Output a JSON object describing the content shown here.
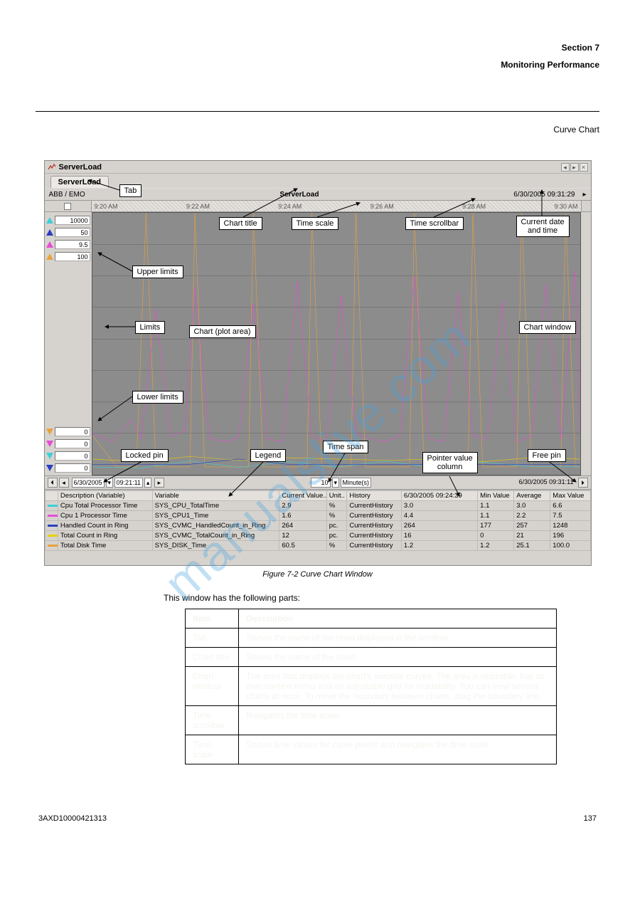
{
  "header": {
    "section_num": "Section 7",
    "section_title": "Monitoring Performance",
    "subtitle": "Curve Chart"
  },
  "watermark": "manualslive.com",
  "window": {
    "title": "ServerLoad",
    "tab_label": "ServerLoad",
    "path_left": "ABB / EMO",
    "path_center": "ServerLoad",
    "datetime_topright": "6/30/2005 09:31:29",
    "time_ticks": [
      "9:20 AM",
      "9:22 AM",
      "9:24 AM",
      "9:26 AM",
      "9:28 AM",
      "9:30 AM"
    ],
    "upper_limits": [
      {
        "color": "#3dd0d6",
        "value": "10000"
      },
      {
        "color": "#2a3ec0",
        "value": "50"
      },
      {
        "color": "#e84bd6",
        "value": "9.5"
      },
      {
        "color": "#e8a23c",
        "value": "100"
      }
    ],
    "lower_limits": [
      {
        "color": "#e8a23c",
        "value": "0"
      },
      {
        "color": "#e84bd6",
        "value": "0"
      },
      {
        "color": "#3dd0d6",
        "value": "0"
      },
      {
        "color": "#2a3ec0",
        "value": "0"
      }
    ],
    "bottombar": {
      "date": "6/30/2005",
      "time": "09:21:11",
      "span_value": "10",
      "span_unit": "Minute(s)",
      "right_datetime": "6/30/2005 09:31:11"
    },
    "legend_headers": [
      "",
      "Description (Variable)",
      "Variable",
      "Current Value..",
      "Unit..",
      "History",
      "6/30/2005 09:24:39",
      "Min Value",
      "Average",
      "Max Value"
    ],
    "legend_rows": [
      {
        "color": "#3dd0d6",
        "desc": "Cpu Total Processor Time",
        "var": "SYS_CPU_TotalTime",
        "cv": "2.9",
        "unit": "%",
        "hist": "CurrentHistory",
        "pv": "3.0",
        "min": "1.1",
        "avg": "3.0",
        "max": "6.6"
      },
      {
        "color": "#e84bd6",
        "desc": "Cpu 1 Processor Time",
        "var": "SYS_CPU1_Time",
        "cv": "1.6",
        "unit": "%",
        "hist": "CurrentHistory",
        "pv": "4.4",
        "min": "1.1",
        "avg": "2.2",
        "max": "7.5"
      },
      {
        "color": "#2a3ec0",
        "desc": "Handled Count in Ring",
        "var": "SYS_CVMC_HandledCount_in_Ring",
        "cv": "264",
        "unit": "pc.",
        "hist": "CurrentHistory",
        "pv": "264",
        "min": "177",
        "avg": "257",
        "max": "1248"
      },
      {
        "color": "#e8d000",
        "desc": "Total Count in Ring",
        "var": "SYS_CVMC_TotalCount_in_Ring",
        "cv": "12",
        "unit": "pc.",
        "hist": "CurrentHistory",
        "pv": "16",
        "min": "0",
        "avg": "21",
        "max": "196"
      },
      {
        "color": "#e8a23c",
        "desc": "Total Disk Time",
        "var": "SYS_DISK_Time",
        "cv": "60.5",
        "unit": "%",
        "hist": "CurrentHistory",
        "pv": "1.2",
        "min": "1.2",
        "avg": "25.1",
        "max": "100.0"
      }
    ]
  },
  "callouts": {
    "tab": "Tab",
    "chart_title": "Chart title",
    "time_scale": "Time scale",
    "time_scrollbar": "Time scrollbar",
    "current_dt": "Current date\nand time",
    "upper_limits": "Upper limits",
    "limits": "Limits",
    "chart_plot": "Chart (plot area)",
    "chart_window": "Chart window",
    "lower_limits": "Lower limits",
    "locked_pin": "Locked pin",
    "legend": "Legend",
    "time_span": "Time span",
    "pointer_value": "Pointer value\ncolumn",
    "free_pin": "Free pin"
  },
  "figure_caption": "Figure 7-2 Curve Chart Window",
  "desc_intro": "This window has the following parts:",
  "desc_table": [
    [
      "Item",
      "Description"
    ],
    [
      "Tab",
      "Shows the name of the chart displayed in the window."
    ],
    [
      "Chart title",
      "Shows the name of the chart."
    ],
    [
      "Chart window",
      "The area that displays the chart's variable curves. The area is resizable, has its own context menu and an adjustable grid for readability. You can view several charts at once. To move the boundary between charts, drag the boundary line."
    ],
    [
      "Time scrollbar",
      "Navigates the time scale."
    ],
    [
      "Time scale",
      "Shows time values for curve points and navigates the time scale."
    ]
  ],
  "footer": {
    "left": "3AXD10000421313",
    "right": "137"
  },
  "chart_data": {
    "type": "line",
    "title": "ServerLoad",
    "x_ticks": [
      "9:20 AM",
      "9:22 AM",
      "9:24 AM",
      "9:26 AM",
      "9:28 AM",
      "9:30 AM"
    ],
    "series": [
      {
        "name": "Total Disk Time",
        "color": "#e8a23c",
        "unit": "%",
        "ylim": [
          0,
          100
        ],
        "x": [
          0,
          0.5,
          0.9,
          1.1,
          1.3,
          2.0,
          2.1,
          2.3,
          2.5,
          3.2,
          3.3,
          3.5,
          3.7,
          4.4,
          4.5,
          4.7,
          4.9,
          5.3,
          5.4,
          5.6,
          5.8,
          6.5,
          6.6,
          6.8,
          7.0,
          7.7,
          7.8,
          8.0,
          8.2,
          8.7,
          8.8,
          9.0,
          9.2,
          9.6,
          9.7,
          9.9,
          10
        ],
        "y": [
          15,
          3,
          3,
          100,
          3,
          3,
          100,
          3,
          3,
          3,
          100,
          3,
          3,
          3,
          100,
          3,
          3,
          3,
          100,
          3,
          3,
          3,
          100,
          3,
          3,
          3,
          100,
          3,
          3,
          3,
          100,
          3,
          3,
          3,
          100,
          3,
          3
        ]
      },
      {
        "name": "Cpu 1 Processor Time",
        "color": "#e84bd6",
        "unit": "%",
        "ylim": [
          0,
          9.5
        ],
        "x": [
          0,
          0.4,
          0.8,
          1.0,
          1.3,
          1.6,
          1.9,
          2.1,
          2.4,
          2.8,
          3.0,
          3.3,
          3.6,
          3.9,
          4.2,
          4.5,
          4.8,
          5.1,
          5.4,
          5.7,
          6.0,
          6.3,
          6.6,
          6.9,
          7.2,
          7.5,
          7.8,
          8.1,
          8.4,
          8.7,
          9.0,
          9.3,
          9.6,
          9.9,
          10
        ],
        "y": [
          1.5,
          1.2,
          2.0,
          1.3,
          6.0,
          1.4,
          1.6,
          6.8,
          1.3,
          1.2,
          1.4,
          6.2,
          1.3,
          1.2,
          7.0,
          1.4,
          1.2,
          6.5,
          1.5,
          1.3,
          1.2,
          1.4,
          7.2,
          1.3,
          1.2,
          6.6,
          1.4,
          1.3,
          6.3,
          1.2,
          1.4,
          6.9,
          1.3,
          7.4,
          1.5
        ]
      },
      {
        "name": "Cpu Total Processor Time",
        "color": "#3dd0d6",
        "unit": "%",
        "ylim": [
          0,
          10000
        ],
        "x": [
          0,
          1,
          2,
          3,
          4,
          5,
          6,
          7,
          8,
          9,
          10
        ],
        "y": [
          300,
          260,
          520,
          280,
          500,
          300,
          510,
          290,
          480,
          310,
          300
        ]
      },
      {
        "name": "Handled Count in Ring",
        "color": "#2a3ec0",
        "unit": "pc.",
        "ylim": [
          0,
          50
        ],
        "x": [
          0,
          1,
          2,
          3,
          4,
          5,
          6,
          7,
          8,
          9,
          10
        ],
        "y": [
          2,
          2,
          2,
          3,
          2,
          2,
          2,
          2,
          2,
          2,
          2
        ]
      },
      {
        "name": "Total Count in Ring",
        "color": "#e8d000",
        "unit": "pc.",
        "ylim": [
          0,
          200
        ],
        "x": [
          0,
          1,
          2,
          3,
          4,
          5,
          6,
          7,
          8,
          9,
          10
        ],
        "y": [
          12,
          10,
          14,
          11,
          13,
          12,
          11,
          12,
          10,
          13,
          12
        ]
      }
    ]
  }
}
